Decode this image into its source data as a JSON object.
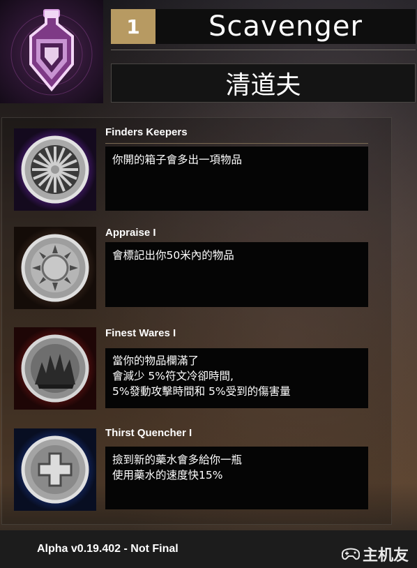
{
  "header": {
    "level": "1",
    "title": "Scavenger",
    "subtitle": "清道夫",
    "icon": "potion-bottle-icon"
  },
  "skills": [
    {
      "name": "Finders Keepers",
      "icon": "wheel-spokes-icon",
      "accent": "#7a32b8",
      "desc": [
        "你開的箱子會多出一項物品"
      ]
    },
    {
      "name": "Appraise I",
      "icon": "gear-sun-icon",
      "accent": "#6b4a36",
      "desc": [
        "會標記出你50米內的物品"
      ]
    },
    {
      "name": "Finest Wares I",
      "icon": "crown-burst-icon",
      "accent": "#a82828",
      "desc": [
        "當你的物品欄滿了",
        "會減少 5%符文冷卻時間,",
        "5%發動攻擊時間和 5%受到的傷害量"
      ]
    },
    {
      "name": "Thirst Quencher I",
      "icon": "plus-cross-icon",
      "accent": "#2a52c8",
      "desc": [
        "撿到新的藥水會多給你一瓶",
        "使用藥水的速度快15%"
      ]
    }
  ],
  "footer": {
    "version": "Alpha v0.19.402 - Not Final",
    "watermark": "主机友"
  }
}
